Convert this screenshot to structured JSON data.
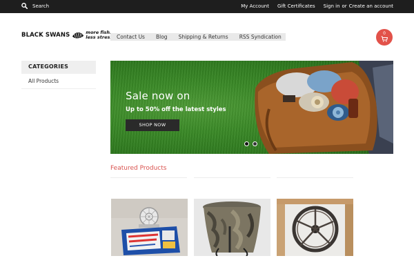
{
  "topbar": {
    "search_label": "Search",
    "my_account": "My Account",
    "gift_certificates": "Gift Certificates",
    "sign_in": "Sign in",
    "or": "or",
    "create_account": "Create an account"
  },
  "header": {
    "brand": "BLACK SWANS",
    "tagline_line1": "more fish.",
    "tagline_line2": "less stress.",
    "cart_count": "0"
  },
  "nav": {
    "items": [
      {
        "label": "Contact Us"
      },
      {
        "label": "Blog"
      },
      {
        "label": "Shipping & Returns"
      },
      {
        "label": "RSS Syndication"
      }
    ]
  },
  "sidebar": {
    "heading": "CATEGORIES",
    "items": [
      {
        "label": "All Products"
      }
    ]
  },
  "hero": {
    "title": "Sale now on",
    "subtitle": "Up to 50% off the latest styles",
    "button": "SHOP NOW"
  },
  "featured": {
    "title": "Featured Products",
    "products": [
      {
        "image": "fishing-reel-product"
      },
      {
        "image": "camo-pop-up-bag-product"
      },
      {
        "image": "rubber-wheel-product"
      }
    ]
  },
  "colors": {
    "topbar_bg": "#1e1e1e",
    "accent": "#e2524a",
    "featured_title": "#d9534f",
    "nav_bg": "#e9e9e9",
    "hero_green": "#3b8a28"
  }
}
